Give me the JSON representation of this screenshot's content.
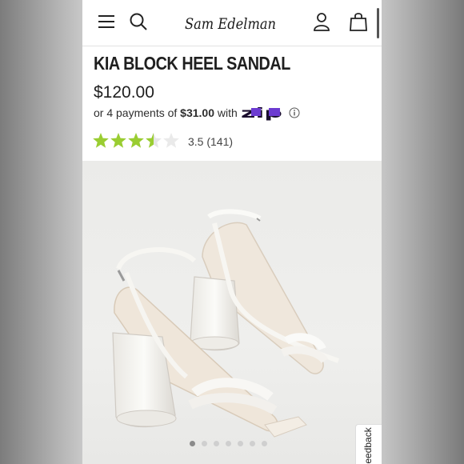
{
  "header": {
    "brand": "Sam Edelman",
    "icons": [
      "menu-icon",
      "search-icon",
      "account-icon",
      "shopping-bag-icon"
    ]
  },
  "product": {
    "title": "KIA BLOCK HEEL SANDAL",
    "price": "$120.00",
    "payments_prefix": "or 4 payments of",
    "payments_amount": "$31.00",
    "payments_suffix": "with",
    "payment_provider": "Zip"
  },
  "rating": {
    "value": 3.5,
    "max": 5,
    "text": "3.5 (141)",
    "star_color": "#9acd32"
  },
  "gallery": {
    "image_count": 7,
    "active_index": 0
  },
  "feedback_label": "Feedback",
  "colors": {
    "zip_purple": "#6c3bd1",
    "text": "#1f1f1f"
  }
}
